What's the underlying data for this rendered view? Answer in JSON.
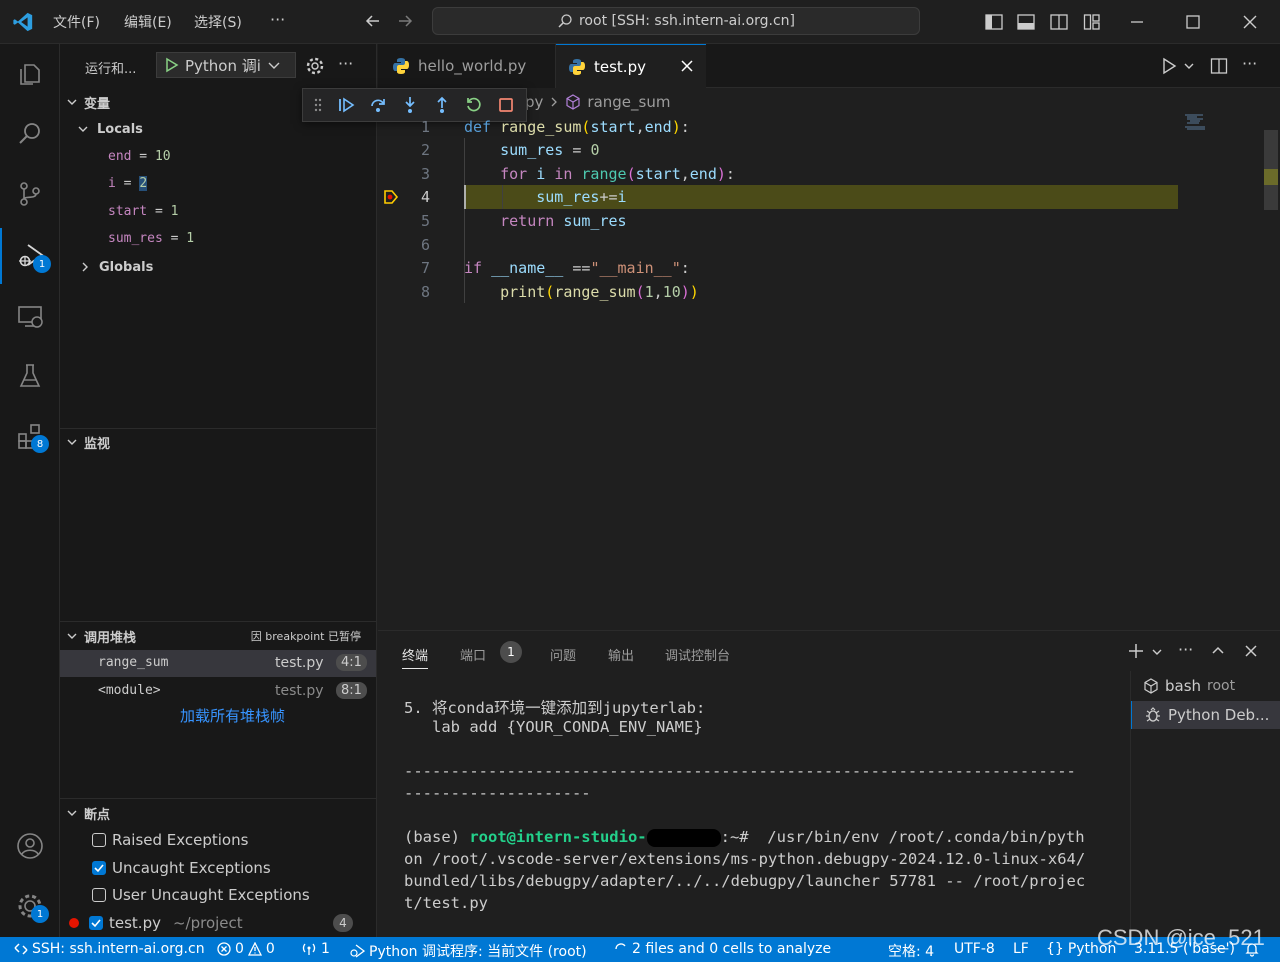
{
  "menu": {
    "file": "文件(F)",
    "edit": "编辑(E)",
    "select": "选择(S)",
    "more": "···"
  },
  "command_center": {
    "text": "root [SSH: ssh.intern-ai.org.cn]"
  },
  "activity": {
    "debug_badge": "1",
    "extensions_badge": "8",
    "settings_badge": "1"
  },
  "run_header": {
    "label": "运行和...",
    "config": "Python 调i"
  },
  "variables": {
    "title": "变量",
    "locals_title": "Locals",
    "locals": [
      {
        "name": "end",
        "eq": " = ",
        "value": "10"
      },
      {
        "name": "i",
        "eq": " = ",
        "value": "2"
      },
      {
        "name": "start",
        "eq": " = ",
        "value": "1"
      },
      {
        "name": "sum_res",
        "eq": " = ",
        "value": "1"
      }
    ],
    "globals_title": "Globals"
  },
  "watch": {
    "title": "监视"
  },
  "callstack": {
    "title": "调用堆栈",
    "status": "因 breakpoint 已暂停",
    "frames": [
      {
        "name": "range_sum",
        "file": "test.py",
        "pos": "4:1"
      },
      {
        "name": "<module>",
        "file": "test.py",
        "pos": "8:1"
      }
    ],
    "load_all": "加载所有堆栈帧"
  },
  "breakpoints": {
    "title": "断点",
    "items": [
      {
        "label": "Raised Exceptions",
        "checked": false
      },
      {
        "label": "Uncaught Exceptions",
        "checked": true
      },
      {
        "label": "User Uncaught Exceptions",
        "checked": false
      }
    ],
    "file": {
      "label": "test.py",
      "path": "~/project",
      "count": "4"
    }
  },
  "tabs": [
    {
      "label": "hello_world.py",
      "active": false
    },
    {
      "label": "test.py",
      "active": true
    }
  ],
  "breadcrumb": {
    "file_tail": "py",
    "symbol": "range_sum"
  },
  "code": {
    "line_numbers": [
      "1",
      "2",
      "3",
      "4",
      "5",
      "6",
      "7",
      "8"
    ],
    "current_line": 4
  },
  "panel": {
    "tabs": [
      {
        "label": "终端",
        "active": true
      },
      {
        "label": "端口",
        "badge": "1"
      },
      {
        "label": "问题"
      },
      {
        "label": "输出"
      },
      {
        "label": "调试控制台"
      }
    ],
    "terminal_lines": [
      "5. 将conda环境一键添加到jupyterlab:",
      "   lab add {YOUR_CONDA_ENV_NAME}",
      "",
      "------------------------------------------------------------------------",
      "--------------------",
      "",
      "",
      "on /root/.vscode-server/extensions/ms-python.debugpy-2024.12.0-linux-x64/",
      "bundled/libs/debugpy/adapter/../../debugpy/launcher 57781 -- /root/projec",
      "t/test.py"
    ],
    "prompt": {
      "env": "(base) ",
      "user": "root@intern-studio-",
      "path": ":~# ",
      "cmd": " /usr/bin/env /root/.conda/bin/pyth"
    },
    "sessions": [
      {
        "label": "bash",
        "sub": "root"
      },
      {
        "label": "Python Deb...",
        "sub": ""
      }
    ]
  },
  "status": {
    "remote": "SSH: ssh.intern-ai.org.cn",
    "errors": "0",
    "warnings": "0",
    "ports": "1",
    "debug": "Python 调试程序: 当前文件 (root)",
    "analysis": "2 files and 0 cells to analyze",
    "spaces": "空格: 4",
    "encoding": "UTF-8",
    "eol": "LF",
    "language": "Python",
    "version": "3.11.5 ('base')"
  },
  "watermark": "CSDN @ice_521",
  "colors": {
    "accent": "#0078d4",
    "current_line": "#4b4b18",
    "stop_arrow": "#ffcc00"
  }
}
